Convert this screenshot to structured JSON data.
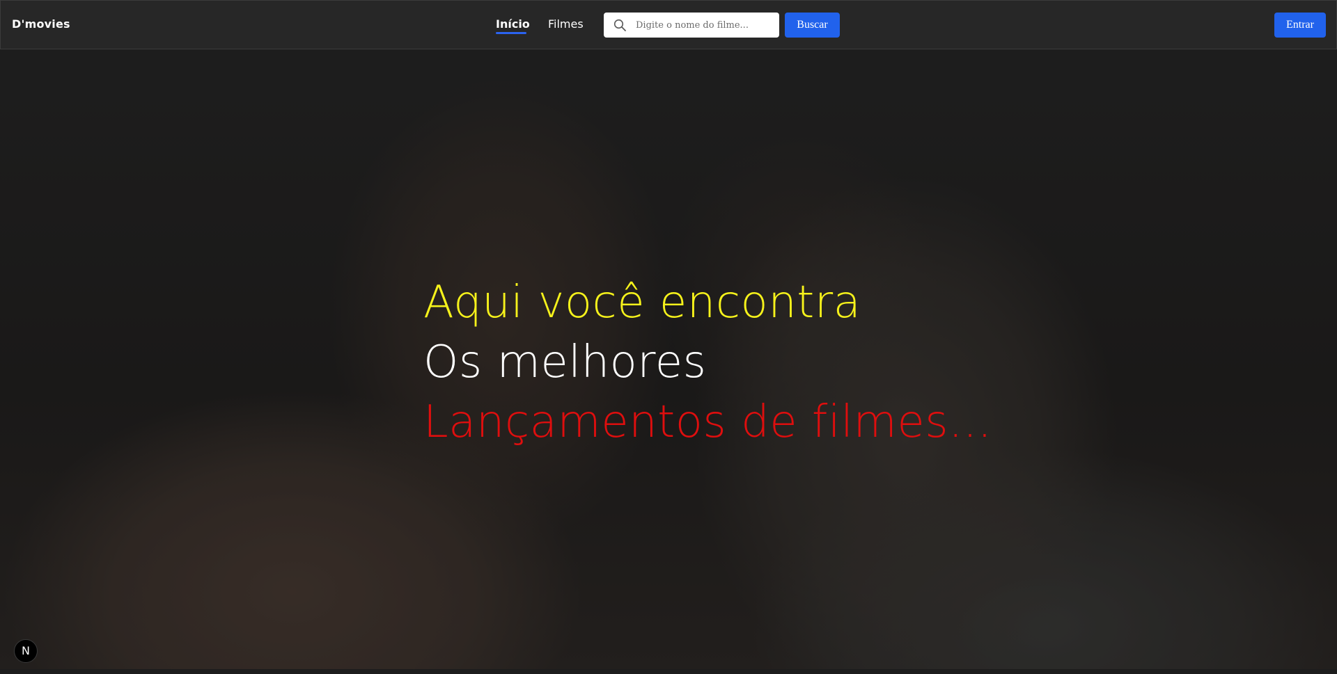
{
  "header": {
    "brand": "D'movies",
    "nav": [
      {
        "label": "Início",
        "active": true
      },
      {
        "label": "Filmes",
        "active": false
      }
    ],
    "search": {
      "placeholder": "Digite o nome do filme...",
      "value": "",
      "button_label": "Buscar"
    },
    "login_label": "Entrar"
  },
  "hero": {
    "lines": [
      "Aqui você encontra",
      "Os melhores",
      "Lançamentos de filmes..."
    ]
  },
  "dev_badge": {
    "label": "N",
    "icon": "nextjs-logo-icon"
  },
  "colors": {
    "accent": "#2162ec",
    "header_bg": "#272727",
    "hero_line_1": "#f6f21b",
    "hero_line_2": "#ffffff",
    "hero_line_3": "#df0e0e"
  }
}
